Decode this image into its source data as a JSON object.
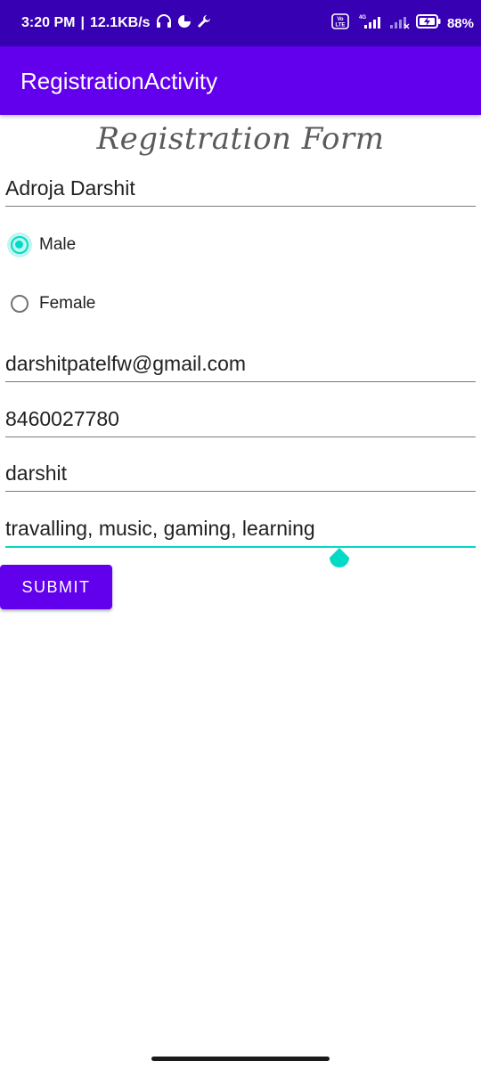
{
  "status_bar": {
    "time": "3:20 PM",
    "network_speed": "12.1KB/s",
    "battery": "88%",
    "icons": [
      "headset-icon",
      "data-saver-icon",
      "wrench-icon",
      "volte-icon",
      "signal-4g-icon",
      "signal-icon",
      "battery-charging-icon"
    ]
  },
  "app_bar": {
    "title": "RegistrationActivity"
  },
  "form": {
    "title": "Registration Form",
    "name_value": "Adroja Darshit",
    "gender_options": [
      {
        "label": "Male",
        "selected": true
      },
      {
        "label": "Female",
        "selected": false
      }
    ],
    "email_value": "darshitpatelfw@gmail.com",
    "phone_value": "8460027780",
    "password_value": "darshit",
    "hobbies_value": "travalling, music, gaming, learning",
    "submit_label": "SUBMIT"
  },
  "colors": {
    "status_bar": "#3700b3",
    "primary": "#6200ee",
    "accent": "#03dac5"
  }
}
